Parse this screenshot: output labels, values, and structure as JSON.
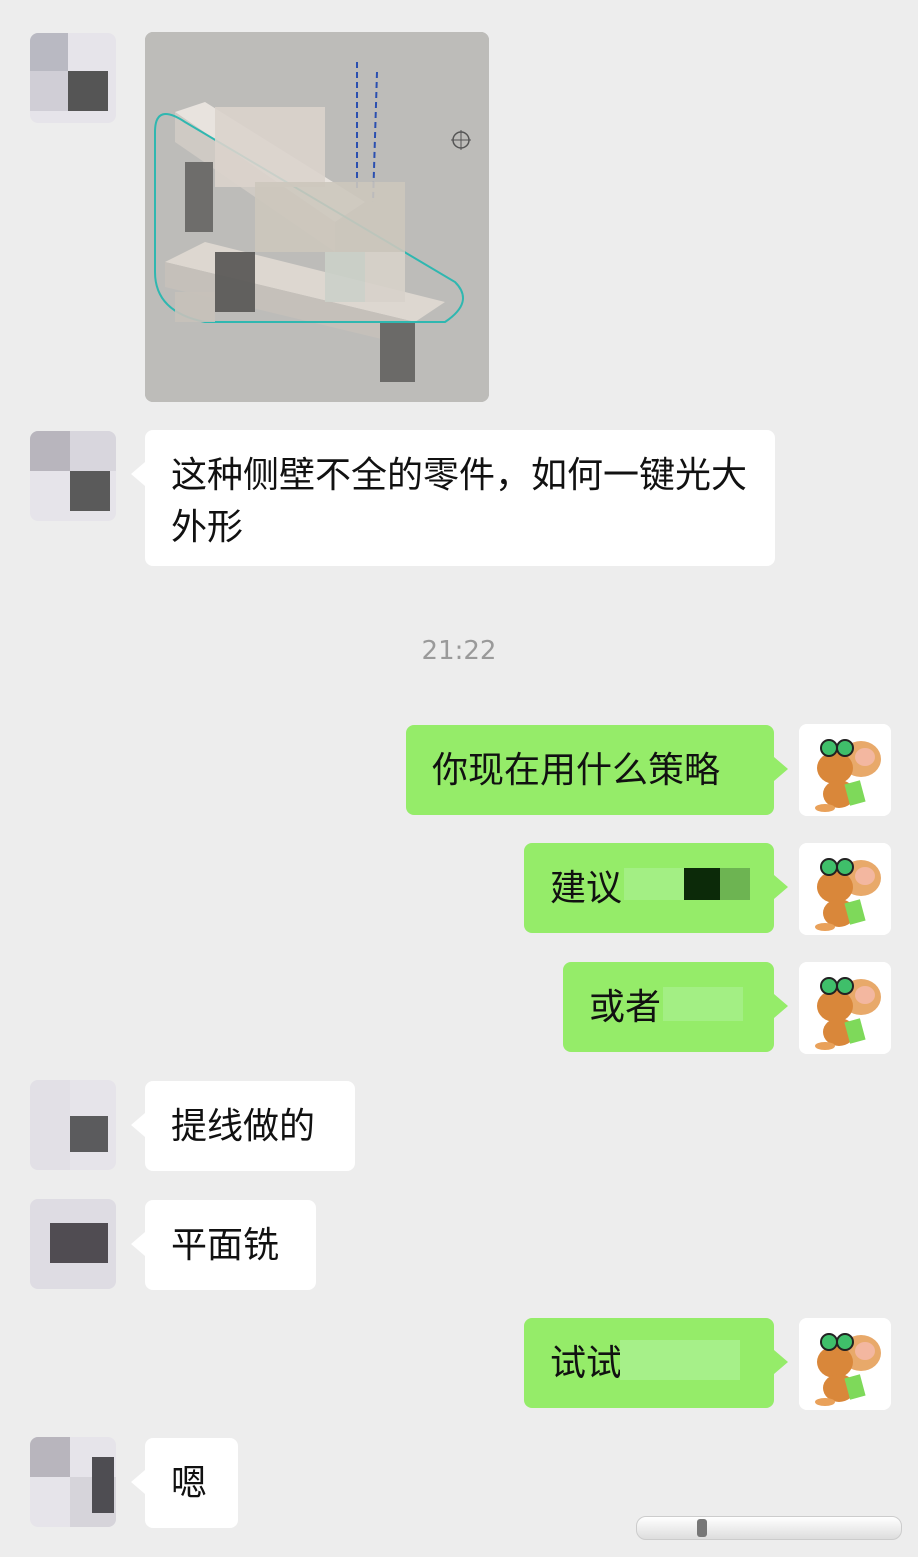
{
  "timestamp": "21:22",
  "messages": [
    {
      "side": "in",
      "type": "image"
    },
    {
      "side": "in",
      "type": "text",
      "text": "这种侧壁不全的零件，如何一键光大外形"
    },
    {
      "side": "out",
      "type": "text",
      "text": "你现在用什么策略"
    },
    {
      "side": "out",
      "type": "text",
      "text": "建议"
    },
    {
      "side": "out",
      "type": "text",
      "text": "或者"
    },
    {
      "side": "in",
      "type": "text",
      "text": "提线做的"
    },
    {
      "side": "in",
      "type": "text",
      "text": "平面铣"
    },
    {
      "side": "out",
      "type": "text",
      "text": "试试"
    },
    {
      "side": "in",
      "type": "text",
      "text": "嗯"
    }
  ],
  "colors": {
    "background": "#ededed",
    "incoming_bubble": "#ffffff",
    "outgoing_bubble": "#95ec69",
    "timestamp": "#9a9a9a"
  },
  "icons": {
    "self_avatar": "jerry-mouse-avatar",
    "peer_avatar": "blurred-avatar"
  }
}
